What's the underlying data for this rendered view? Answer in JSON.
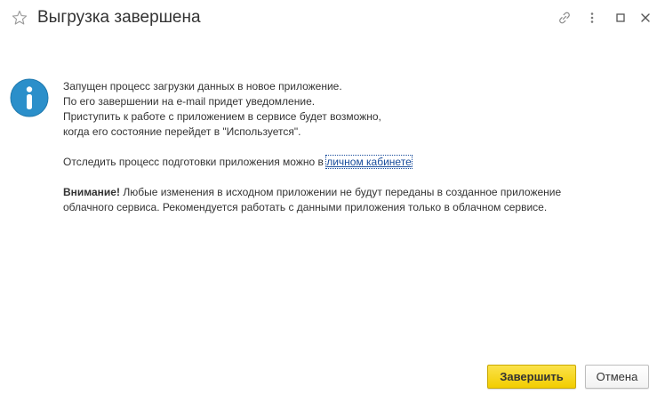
{
  "window": {
    "title": "Выгрузка завершена"
  },
  "titlebar_icons": {
    "favorite": "star-icon",
    "link": "link-icon",
    "more": "more-vertical-icon",
    "maximize": "maximize-icon",
    "close": "close-icon"
  },
  "message": {
    "icon": "info-icon",
    "lines": [
      "Запущен процесс загрузки данных в новое приложение.",
      "По его завершении на e-mail придет уведомление.",
      "Приступить к работе с приложением в сервисе будет возможно,",
      "когда его состояние перейдет в \"Используется\"."
    ],
    "track_text": "Отследить процесс подготовки приложения можно в ",
    "track_link": "личном кабинете",
    "warning_label": "Внимание!",
    "warning_line1": " Любые изменения в исходном приложении не будут переданы в созданное приложение",
    "warning_line2": "облачного сервиса. Рекомендуется работать с данными приложения только в облачном сервисе."
  },
  "buttons": {
    "finish": "Завершить",
    "cancel": "Отмена"
  },
  "colors": {
    "info_icon": "#2b8fca",
    "primary_button": "#f5d300",
    "link": "#1a4d9c"
  }
}
